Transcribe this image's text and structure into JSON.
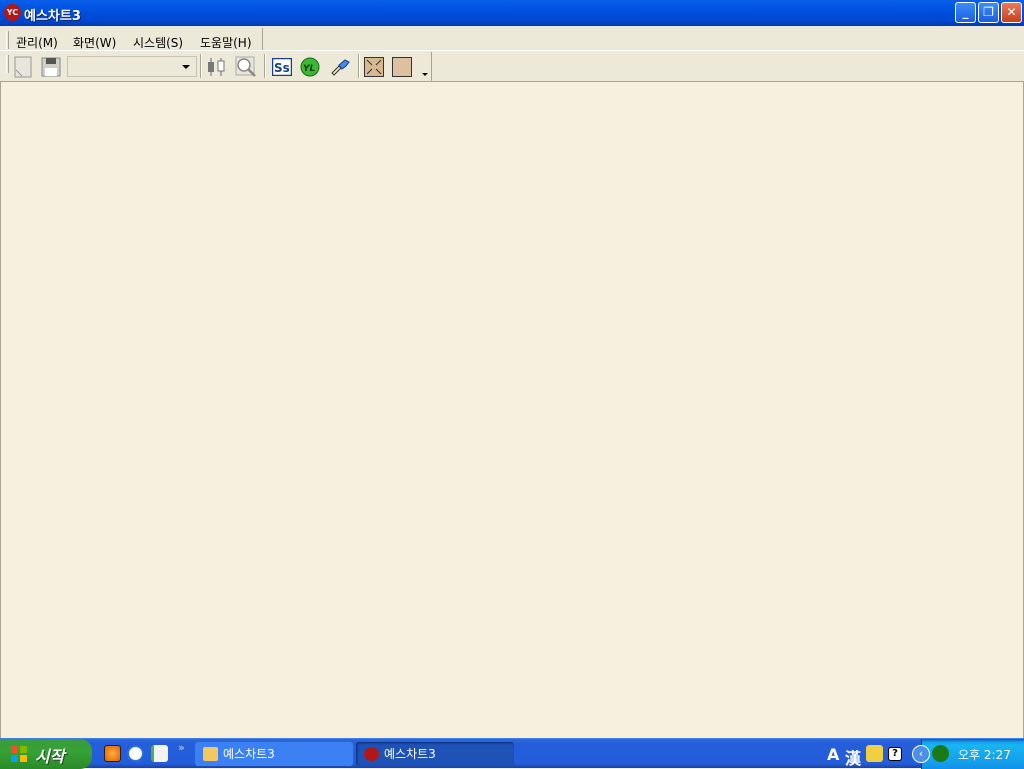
{
  "window": {
    "title": "예스차트3",
    "icon_text": "YC"
  },
  "menu": {
    "items": [
      {
        "label": "관리(M)"
      },
      {
        "label": "화면(W)"
      },
      {
        "label": "시스템(S)"
      },
      {
        "label": "도움말(H)"
      }
    ]
  },
  "toolbar": {
    "combo_value": "",
    "icons": [
      "new-document-icon",
      "save-icon",
      "candlestick-icon",
      "zoom-icon",
      "ss-icon",
      "yl-icon",
      "wrench-icon",
      "fullscreen-icon",
      "color-box-icon"
    ]
  },
  "taskbar": {
    "start_label": "시작",
    "tasks": [
      {
        "label": "예스차트3",
        "icon": "folder-icon"
      },
      {
        "label": "예스차트3",
        "icon": "app-icon"
      }
    ],
    "tray": {
      "lang_a": "A",
      "lang_han": "漢",
      "clock": "오후 2:27"
    }
  }
}
